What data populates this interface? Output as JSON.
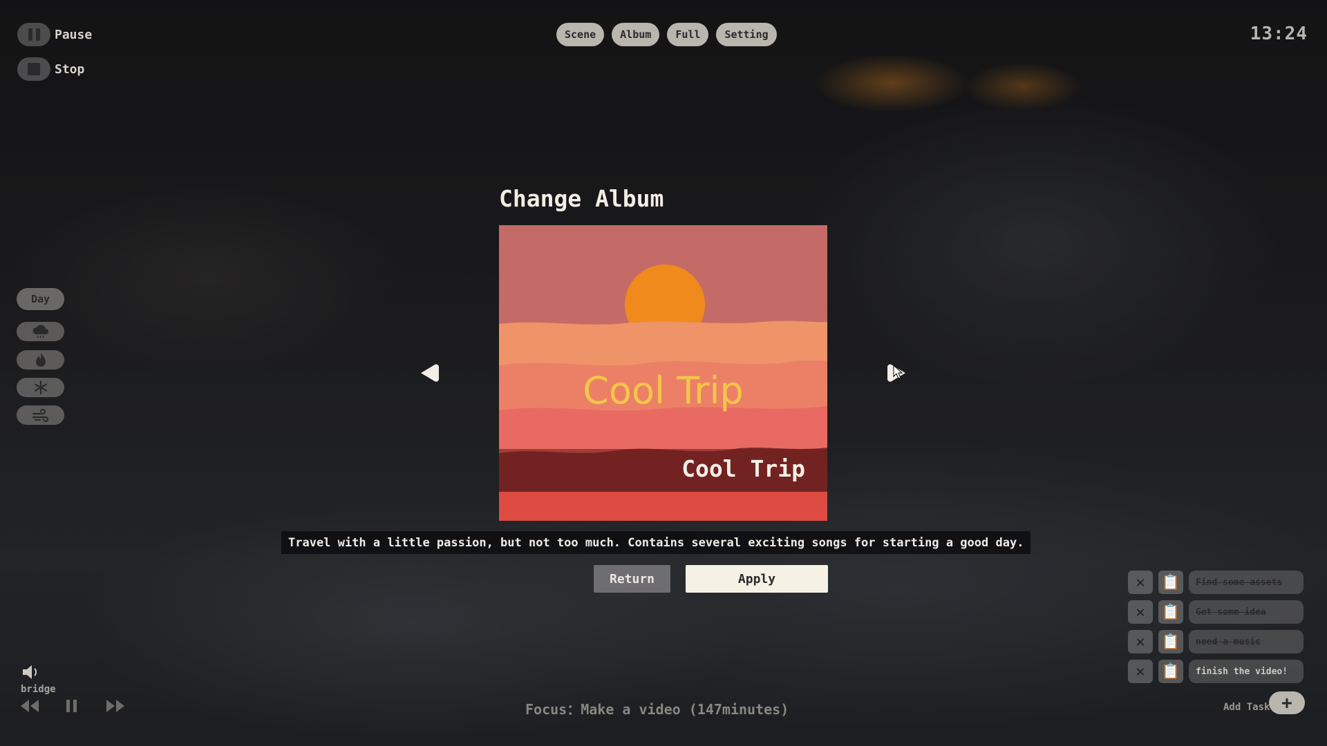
{
  "top_controls": {
    "pause_label": "Pause",
    "stop_label": "Stop"
  },
  "nav": {
    "scene": "Scene",
    "album": "Album",
    "full": "Full",
    "setting": "Setting"
  },
  "clock": "13:24",
  "sidebar": {
    "time_of_day": "Day",
    "weather_icons": [
      "rain-cloud-icon",
      "fire-icon",
      "snowflake-icon",
      "wind-icon"
    ]
  },
  "modal": {
    "title": "Change Album",
    "cover_art_title": "Cool Trip",
    "album_name": "Cool Trip",
    "description": "Travel with a little passion, but not too much. Contains several exciting songs for starting a good day.",
    "return_label": "Return",
    "apply_label": "Apply"
  },
  "tasks": [
    {
      "label": "Find some assets",
      "done": true
    },
    {
      "label": "Get some idea",
      "done": true
    },
    {
      "label": "need a music",
      "done": true
    },
    {
      "label": "finish the video!",
      "done": false
    }
  ],
  "add_task_label": "Add Task",
  "player": {
    "track": "bridge",
    "focus_text": "Focus：Make a video (147minutes)"
  },
  "colors": {
    "accent_light": "#b9b6ae",
    "cover_bg": "#c76a66",
    "sun": "#f08a1c",
    "cover_title": "#f3c64a"
  }
}
